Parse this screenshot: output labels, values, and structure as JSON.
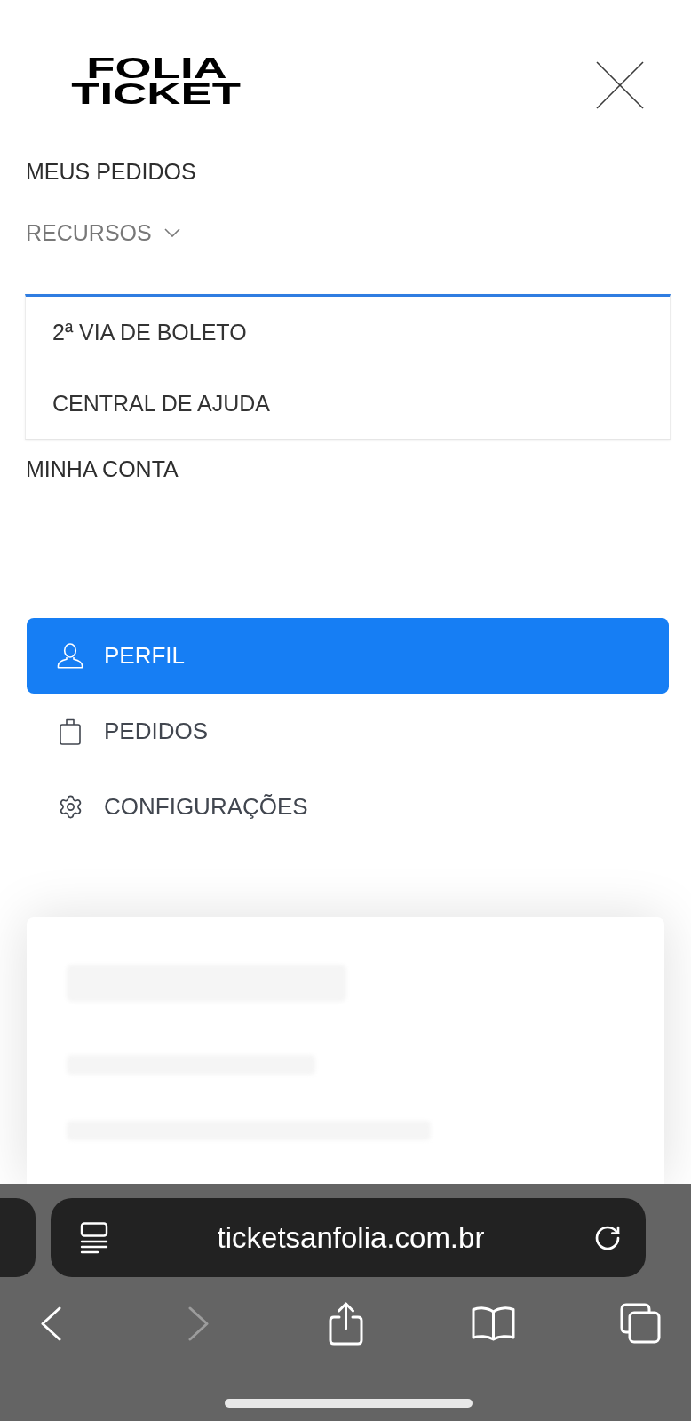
{
  "header": {
    "logo": [
      "FOLIA",
      "TICKET"
    ]
  },
  "nav": [
    {
      "kind": "link",
      "label": "MEUS PEDIDOS"
    },
    {
      "kind": "dropdown",
      "label": "RECURSOS",
      "expanded": true,
      "children": [
        {
          "label": "2ª VIA DE BOLETO"
        },
        {
          "label": "CENTRAL DE AJUDA"
        }
      ]
    },
    {
      "kind": "link",
      "label": "MINHA CONTA"
    }
  ],
  "account_menu": [
    {
      "label": "PERFIL",
      "selected": true
    },
    {
      "label": "PEDIDOS",
      "selected": false
    },
    {
      "label": "CONFIGURAÇÕES",
      "selected": false
    }
  ],
  "browser": {
    "url": "ticketsanfolia.com.br",
    "forward_disabled": true
  }
}
